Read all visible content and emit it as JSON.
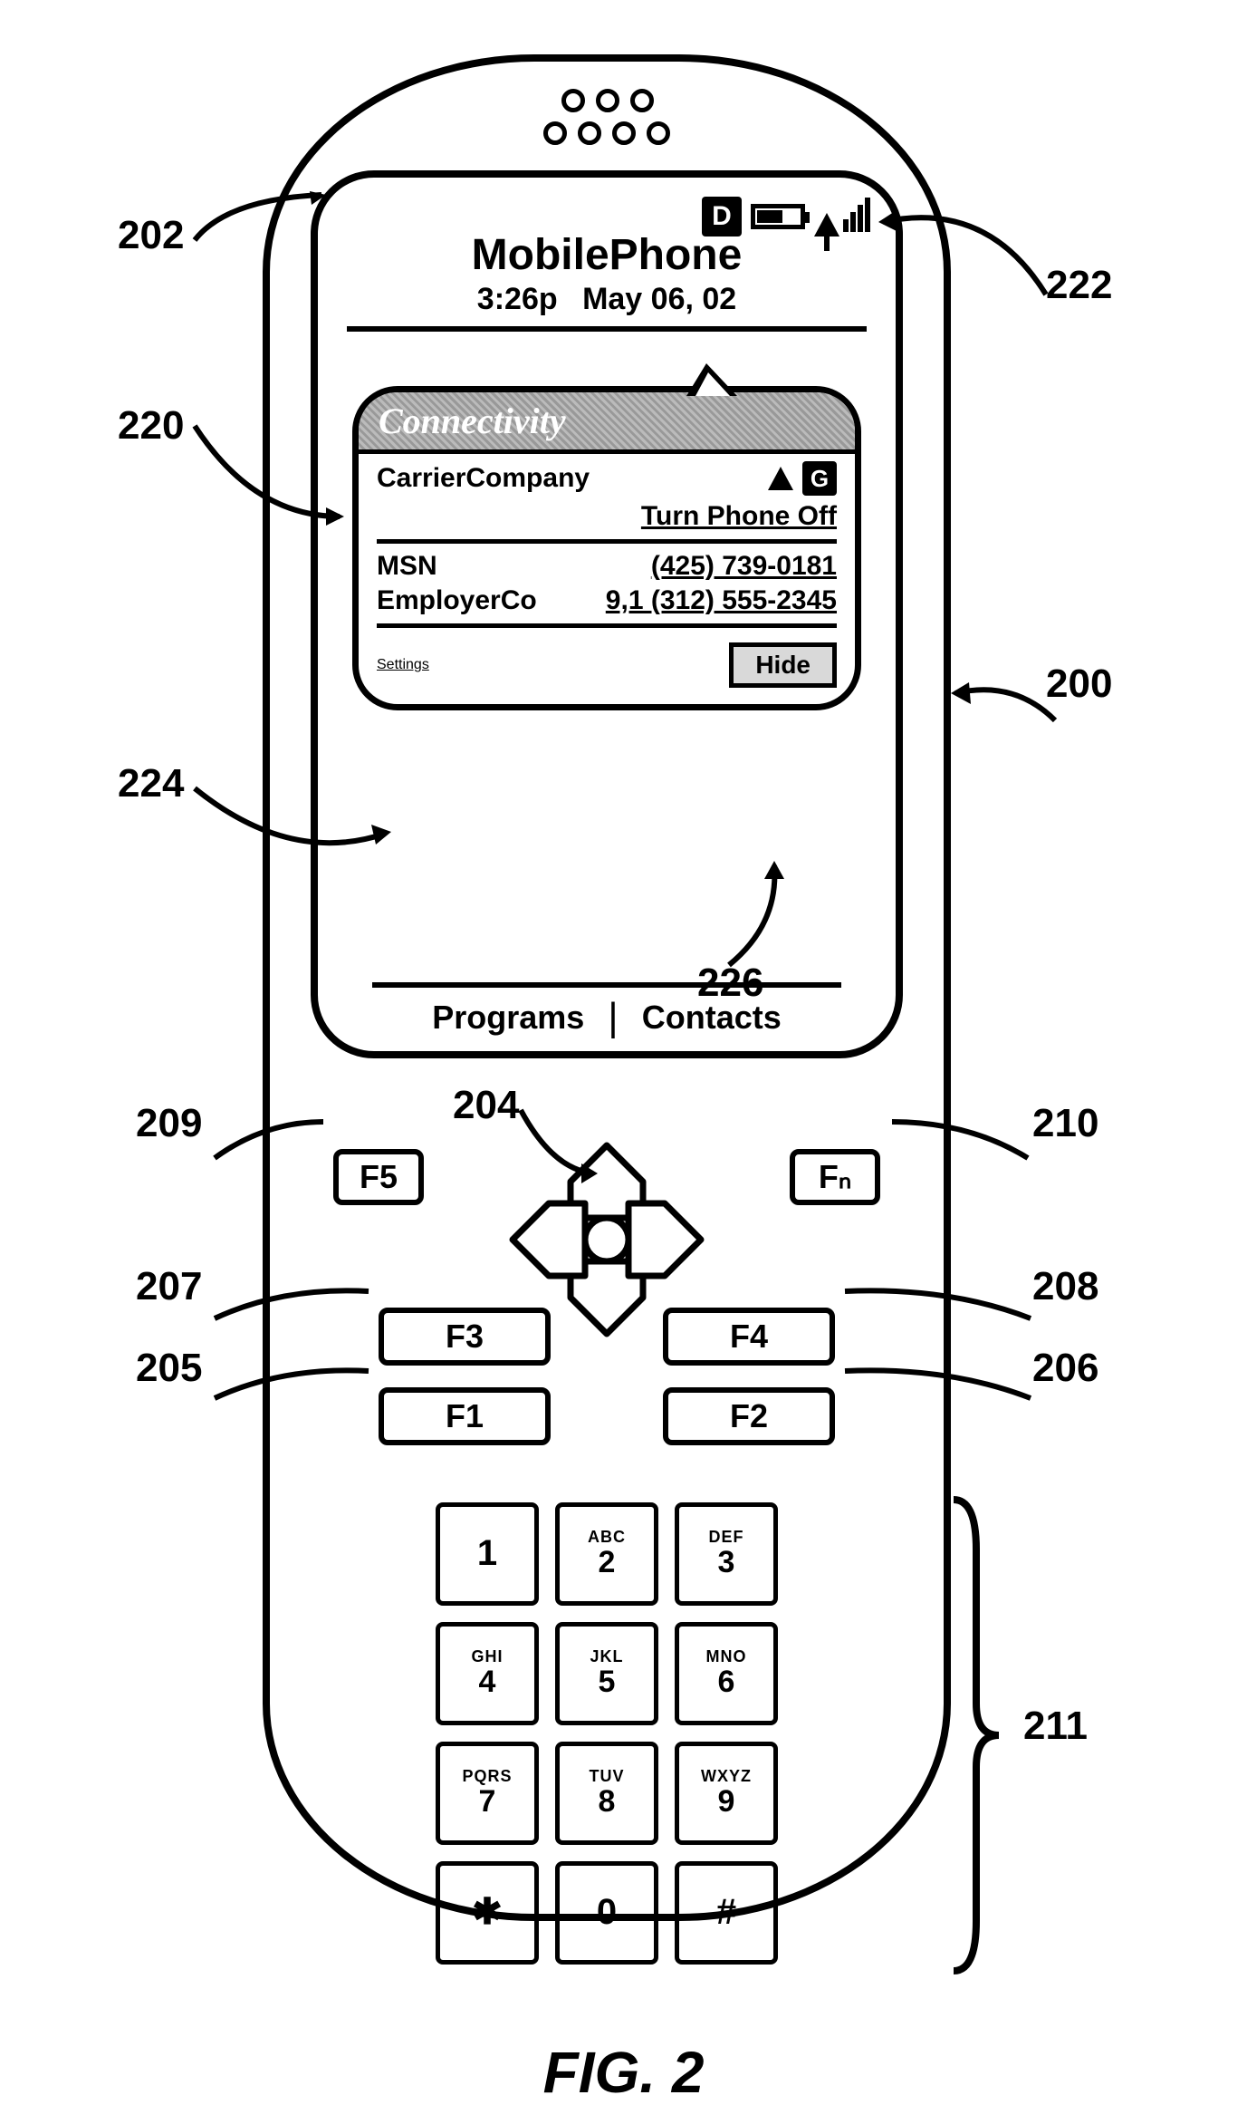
{
  "figure_caption": "FIG. 2",
  "chart_data": {
    "type": "diagram",
    "description": "Patent figure of a mobile phone body (200) with display (202), connectivity popup bubble (220) pointing to signal indicator (222), settings link (224), hide button (226), d-pad (204), function keys F1–F5/Fn (205–210) and numeric keypad (211)."
  },
  "callouts": {
    "c200": "200",
    "c202": "202",
    "c204": "204",
    "c205": "205",
    "c206": "206",
    "c207": "207",
    "c208": "208",
    "c209": "209",
    "c210": "210",
    "c211": "211",
    "c220": "220",
    "c222": "222",
    "c224": "224",
    "c226": "226"
  },
  "status": {
    "d_badge": "D"
  },
  "header": {
    "title": "MobilePhone",
    "time": "3:26p",
    "date": "May 06, 02"
  },
  "bubble": {
    "title": "Connectivity",
    "carrier_label": "CarrierCompany",
    "g_badge": "G",
    "turn_off": "Turn Phone Off",
    "row_msn_label": "MSN",
    "row_msn_value": "(425) 739-0181",
    "row_emp_label": "EmployerCo",
    "row_emp_value": "9,1 (312) 555-2345",
    "settings": "Settings",
    "hide": "Hide"
  },
  "softkeys": {
    "left": "Programs",
    "right": "Contacts"
  },
  "fkeys": {
    "f1": "F1",
    "f2": "F2",
    "f3": "F3",
    "f4": "F4",
    "f5": "F5",
    "fn": "Fₙ"
  },
  "keypad": [
    {
      "sub": "",
      "main": "1"
    },
    {
      "sub": "ABC",
      "main": "2"
    },
    {
      "sub": "DEF",
      "main": "3"
    },
    {
      "sub": "GHI",
      "main": "4"
    },
    {
      "sub": "JKL",
      "main": "5"
    },
    {
      "sub": "MNO",
      "main": "6"
    },
    {
      "sub": "PQRS",
      "main": "7"
    },
    {
      "sub": "TUV",
      "main": "8"
    },
    {
      "sub": "WXYZ",
      "main": "9"
    },
    {
      "sub": "",
      "main": "✱"
    },
    {
      "sub": "",
      "main": "0"
    },
    {
      "sub": "",
      "main": "#"
    }
  ]
}
